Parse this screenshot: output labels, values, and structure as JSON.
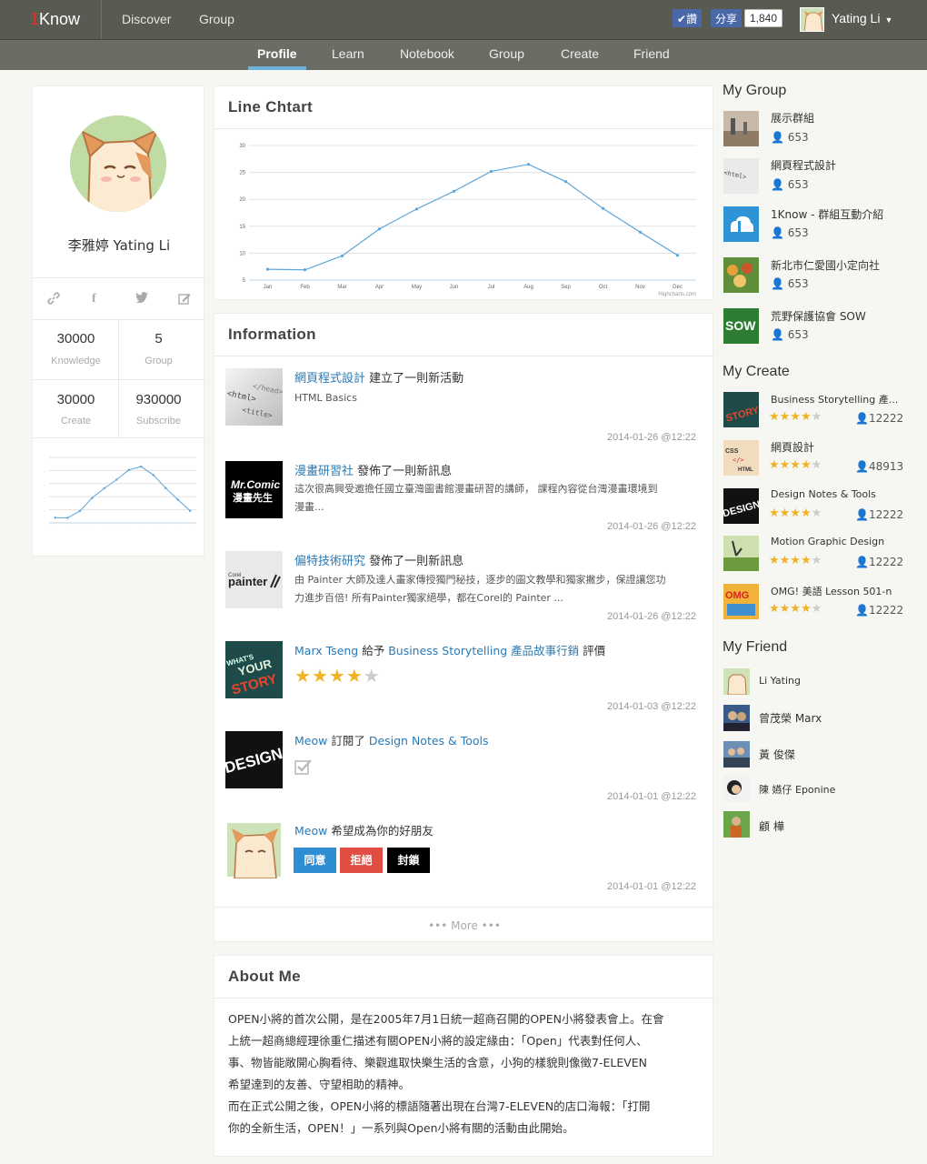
{
  "header": {
    "logo_num": "1",
    "logo_text": "Know",
    "nav": [
      "Discover",
      "Group"
    ],
    "fb_like": "讚",
    "fb_share": "分享",
    "fb_count": "1,840",
    "user_name": "Yating Li"
  },
  "subnav": [
    "Profile",
    "Learn",
    "Notebook",
    "Group",
    "Create",
    "Friend"
  ],
  "profile": {
    "name": "李雅婷 Yating Li",
    "stats": [
      {
        "num": "30000",
        "label": "Knowledge"
      },
      {
        "num": "5",
        "label": "Group"
      },
      {
        "num": "30000",
        "label": "Create"
      },
      {
        "num": "930000",
        "label": "Subscribe"
      }
    ]
  },
  "line_chart": {
    "title": "Line Chtart",
    "credit": "Highcharts.com"
  },
  "chart_data": {
    "type": "line",
    "categories": [
      "Jan",
      "Feb",
      "Mar",
      "Apr",
      "May",
      "Jun",
      "Jul",
      "Aug",
      "Sep",
      "Oct",
      "Nov",
      "Dec"
    ],
    "series": [
      {
        "values": [
          7.0,
          6.9,
          9.5,
          14.5,
          18.2,
          21.5,
          25.2,
          26.5,
          23.3,
          18.3,
          13.9,
          9.6
        ]
      }
    ],
    "yticks": [
      "5",
      "10",
      "15",
      "20",
      "25",
      "30"
    ],
    "ylim": [
      5,
      30
    ],
    "grid": true,
    "title": "",
    "xlabel": "",
    "ylabel": ""
  },
  "information": {
    "title": "Information",
    "feed": [
      {
        "actor": "網頁程式設計",
        "action": " 建立了一則新活動",
        "desc": "HTML Basics",
        "time": "2014-01-26 @12:22"
      },
      {
        "actor": "漫畫研習社",
        "action": " 發佈了一則新訊息",
        "desc": "這次很高興受邀擔任國立臺灣圖書館漫畫研習的講師， 課程內容從台灣漫畫環境到漫畫...",
        "time": "2014-01-26 @12:22"
      },
      {
        "actor": "偏特技術研究",
        "action": " 發佈了一則新訊息",
        "desc": "由 Painter 大師及達人畫家傳授獨門秘技，逐步的圖文教學和獨家撇步，保證讓您功力進步百倍! 所有Painter獨家絕學，都在Corel的 Painter ...",
        "time": "2014-01-26 @12:22"
      },
      {
        "actor": "Marx Tseng",
        "action": " 給予 ",
        "target": "Business Storytelling 產品故事行銷",
        "after": " 評價",
        "rating": 4,
        "time": "2014-01-03 @12:22"
      },
      {
        "actor": "Meow",
        "action": " 訂閱了 ",
        "target": "Design Notes & Tools",
        "time": "2014-01-01 @12:22"
      },
      {
        "actor": "Meow",
        "action": " 希望成為你的好朋友",
        "time": "2014-01-01 @12:22"
      }
    ],
    "buttons": {
      "agree": "同意",
      "reject": "拒絕",
      "block": "封鎖"
    },
    "more": "••• More •••",
    "thumbs": [
      "Mr.Comic 漫畫先生",
      "painter",
      "WHAT'S YOUR STORY",
      "DESIGN"
    ]
  },
  "about": {
    "title": "About Me",
    "lines": [
      "OPEN小將的首次公開，是在2005年7月1日統一超商召開的OPEN小將發表會上。在會",
      "上統一超商總經理徐重仁描述有關OPEN小將的設定緣由：「Open」代表對任何人、",
      "事、物皆能敞開心胸看待、樂觀進取快樂生活的含意，小狗的樣貌則像徵7-ELEVEN",
      "希望達到的友善、守望相助的精神。",
      "而在正式公開之後，OPEN小將的標語隨著出現在台灣7-ELEVEN的店口海報：「打開",
      "你的全新生活，OPEN！」一系列與Open小將有關的活動由此開始。"
    ]
  },
  "my_group": {
    "title": "My Group",
    "items": [
      {
        "name": "展示群組",
        "count": "653"
      },
      {
        "name": "網頁程式設計",
        "count": "653"
      },
      {
        "name": "1Know - 群組互動介紹",
        "count": "653"
      },
      {
        "name": "新北市仁愛國小定向社",
        "count": "653"
      },
      {
        "name": "荒野保護協會 SOW",
        "count": "653"
      }
    ]
  },
  "my_create": {
    "title": "My Create",
    "items": [
      {
        "name": "Business Storytelling 產...",
        "rating": 4,
        "count": "12222"
      },
      {
        "name": "網頁設計",
        "rating": 4,
        "count": "48913"
      },
      {
        "name": "Design Notes & Tools",
        "rating": 4,
        "count": "12222"
      },
      {
        "name": "Motion Graphic Design",
        "rating": 4,
        "count": "12222"
      },
      {
        "name": "OMG! 美語 Lesson 501-n",
        "rating": 4,
        "count": "12222"
      }
    ]
  },
  "my_friend": {
    "title": "My Friend",
    "items": [
      "Li Yating",
      "曾茂榮 Marx",
      "黃 俊傑",
      "陳 嬿仔 Eponine",
      "顧 樺"
    ]
  },
  "colors": {
    "accent": "#2a7ab5",
    "star": "#f0b323",
    "chart_line": "#5aa6dd",
    "topbar": "#595a52",
    "subnav": "#6b6c64"
  }
}
